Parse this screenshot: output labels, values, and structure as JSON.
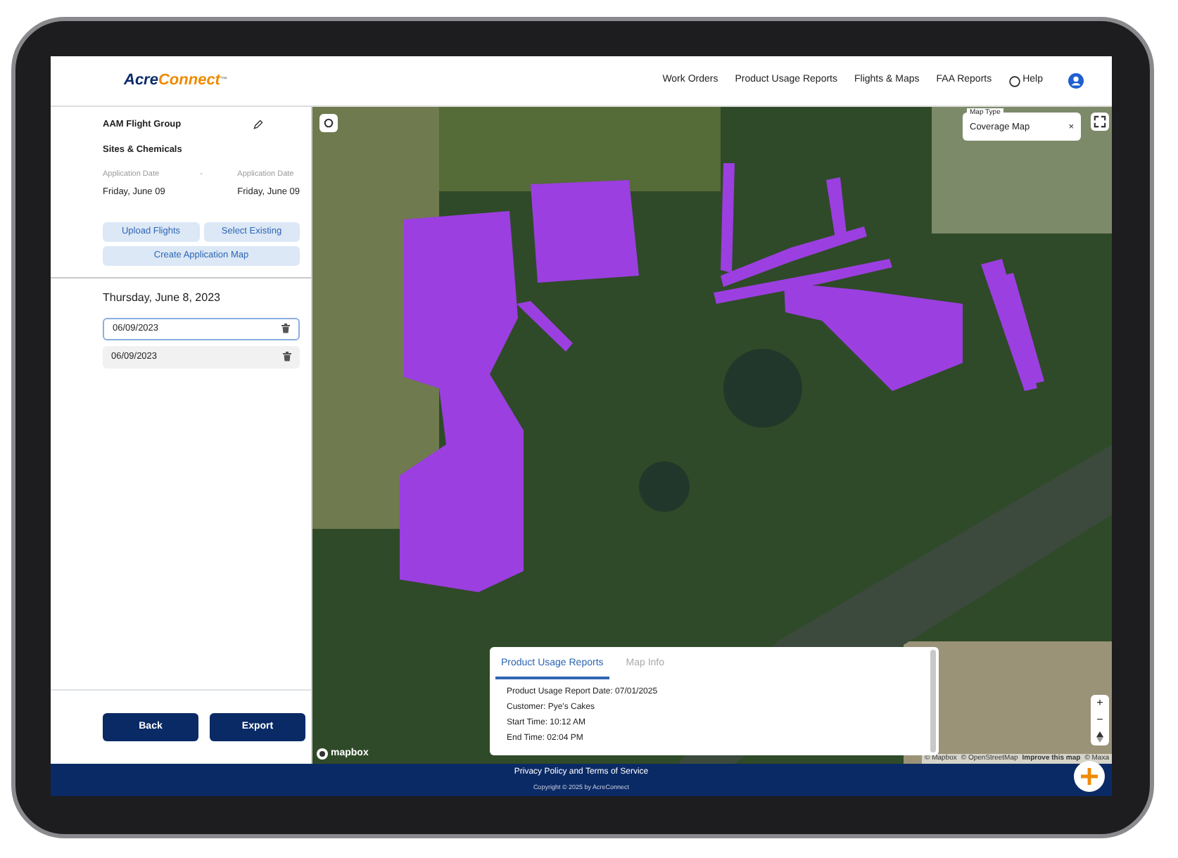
{
  "header": {
    "logo": {
      "first": "Acre",
      "second": "Connect",
      "mark": "™"
    },
    "nav": [
      {
        "label": "Work Orders",
        "kind": "link"
      },
      {
        "label": "Product Usage Reports",
        "kind": "link"
      },
      {
        "label": "Flights & Maps",
        "kind": "link"
      },
      {
        "label": "FAA Reports",
        "kind": "link"
      },
      {
        "label": "Help",
        "kind": "help"
      }
    ]
  },
  "sidebar": {
    "group_title": "AAM Flight Group",
    "subtitle": "Sites & Chemicals",
    "separator": "-",
    "dates": [
      {
        "label": "Application Date",
        "value": "Friday, June 09"
      },
      {
        "label": "Application Date",
        "value": "Friday, June 09"
      }
    ],
    "actions": [
      "Upload Flights",
      "Select Existing",
      "Create Application Map"
    ],
    "day_heading": "Thursday, June 8, 2023",
    "flights": [
      {
        "label": "06/09/2023",
        "selected": true
      },
      {
        "label": "06/09/2023",
        "selected": false
      }
    ],
    "buttons": [
      "Back",
      "Export"
    ]
  },
  "map": {
    "map_type": {
      "label": "Map Type",
      "value": "Coverage Map",
      "close": "×"
    },
    "zoom": [
      "+",
      "−"
    ],
    "logo": "mapbox",
    "attribution": [
      "© Mapbox",
      "© OpenStreetMap",
      "Improve this map",
      "© Maxa"
    ],
    "panel": {
      "tabs": [
        {
          "label": "Product Usage Reports",
          "selected": true
        },
        {
          "label": "Map Info",
          "selected": false
        }
      ],
      "lines": [
        "Product Usage Report Date: 07/01/2025",
        "Customer: Pye's Cakes",
        "Start Time: 10:12 AM",
        "End Time: 02:04 PM"
      ]
    }
  },
  "footer": {
    "link": "Privacy Policy and Terms of Service",
    "copyright": "Copyright © 2025 by AcreConnect"
  }
}
